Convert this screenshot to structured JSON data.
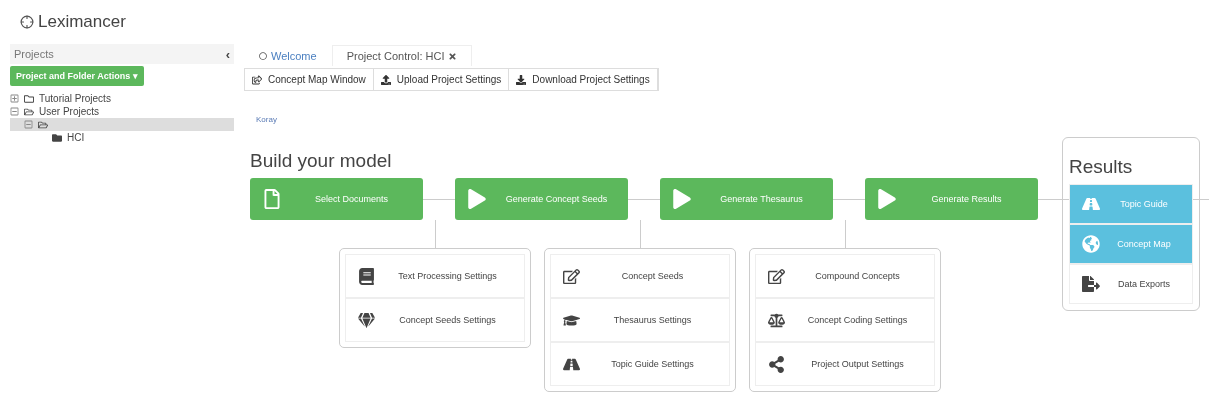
{
  "app": {
    "name": "Leximancer"
  },
  "sidebar": {
    "title": "Projects",
    "collapse": "‹",
    "actions_button": "Project and Folder Actions ▾",
    "tree": [
      {
        "label": "Tutorial Projects",
        "expanded": false,
        "selected": false
      },
      {
        "label": "User Projects",
        "expanded": true,
        "selected": false,
        "children": [
          {
            "expanded": true,
            "selected": true,
            "children": [
              {
                "label": "HCI",
                "expanded": false,
                "selected": false
              }
            ]
          }
        ]
      }
    ]
  },
  "tabs": [
    {
      "label": "Welcome",
      "selected": false,
      "closable": false
    },
    {
      "label": "Project Control: HCI",
      "selected": true,
      "closable": true
    }
  ],
  "toolbar": [
    "Concept Map Window",
    "Upload Project Settings",
    "Download Project Settings"
  ],
  "breadcrumb": "Koray",
  "build": {
    "title": "Build your model",
    "steps": [
      {
        "label": "Select Documents"
      },
      {
        "label": "Generate Concept Seeds",
        "settings": [
          "Text Processing Settings",
          "Concept Seeds Settings"
        ]
      },
      {
        "label": "Generate Thesaurus",
        "settings": [
          "Concept Seeds",
          "Thesaurus Settings",
          "Topic Guide Settings"
        ]
      },
      {
        "label": "Generate Results",
        "settings": [
          "Compound Concepts",
          "Concept Coding Settings",
          "Project Output Settings"
        ]
      }
    ]
  },
  "results": {
    "title": "Results",
    "items": [
      {
        "label": "Topic Guide",
        "active": true
      },
      {
        "label": "Concept Map",
        "active": true
      },
      {
        "label": "Data Exports",
        "active": false
      }
    ]
  }
}
